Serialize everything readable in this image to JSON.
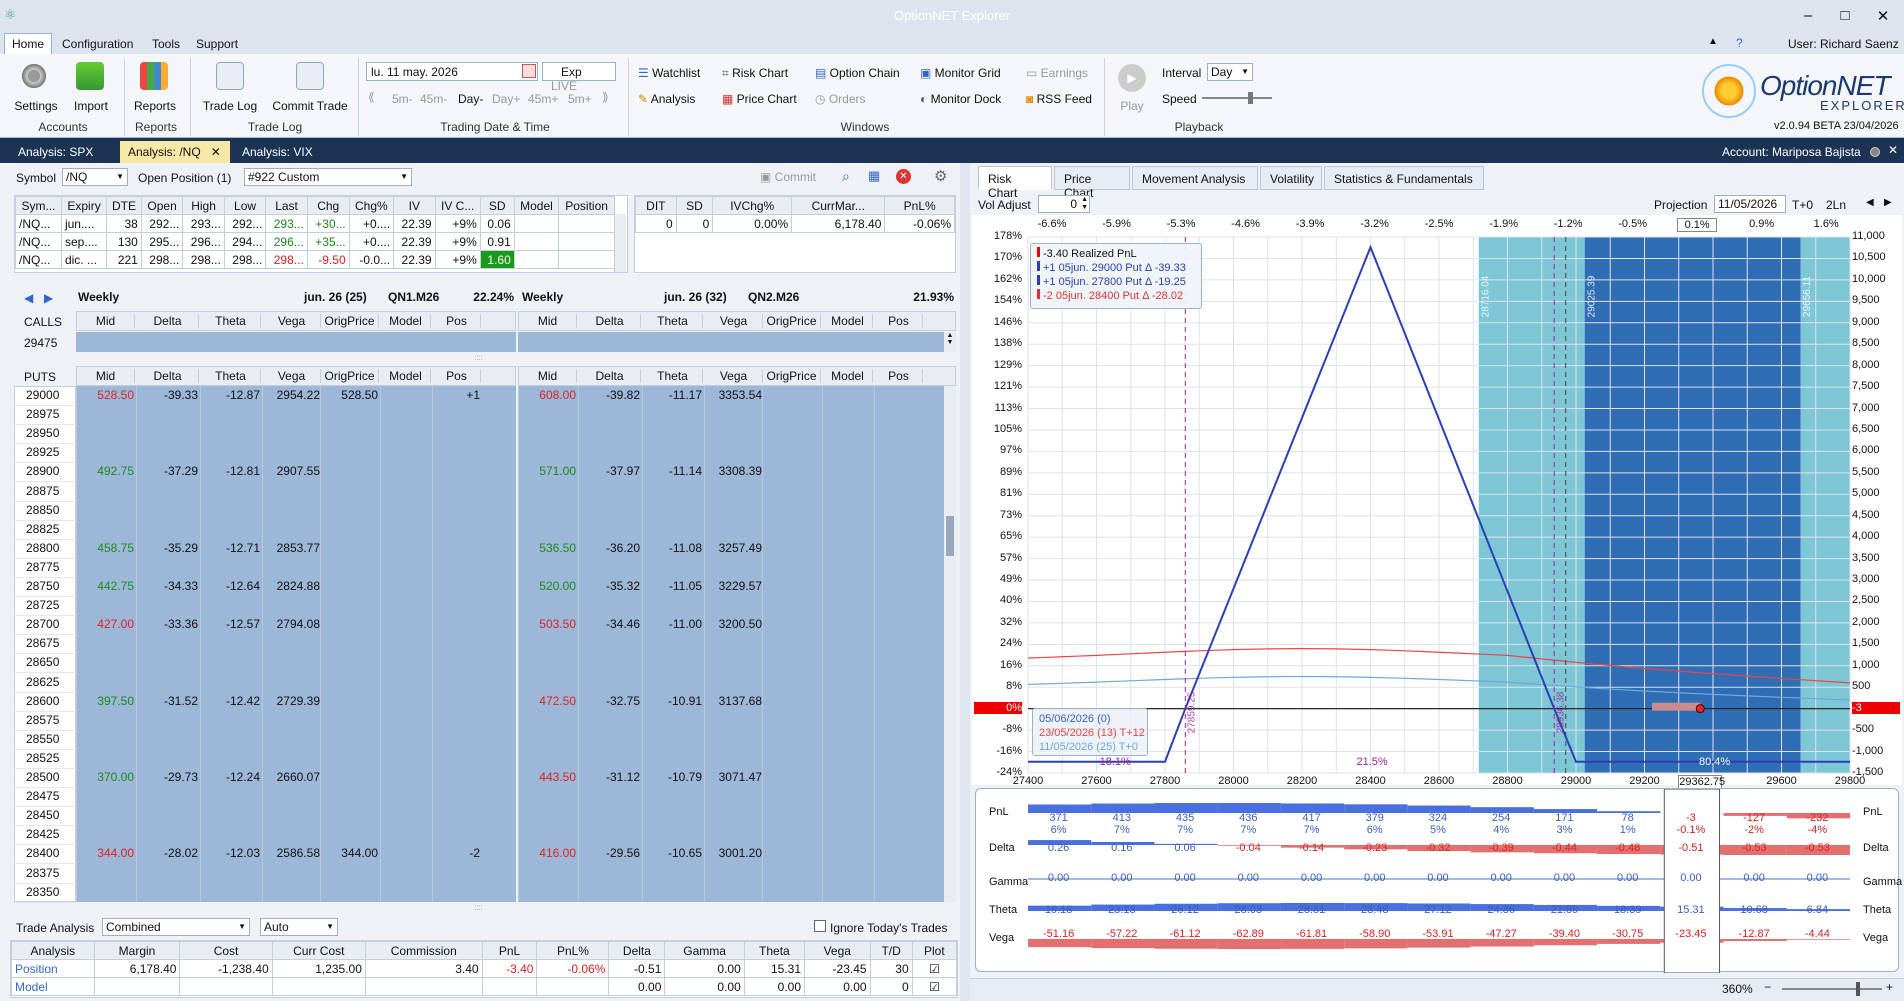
{
  "window": {
    "title": "OptionNET Explorer",
    "user": "User: Richard Saenz",
    "help": "?"
  },
  "menu": [
    "Home",
    "Configuration",
    "Tools",
    "Support"
  ],
  "ribbon": {
    "accounts": {
      "settings": "Settings",
      "import": "Import",
      "group": "Accounts"
    },
    "reports": {
      "reports": "Reports",
      "group": "Reports"
    },
    "tradelog": {
      "tradelog": "Trade Log",
      "commit": "Commit Trade",
      "group": "Trade Log"
    },
    "date": {
      "value": "lu. 11 may. 2026",
      "exp": "Exp",
      "live": "LIVE",
      "steps": [
        "5m-",
        "45m-",
        "Day-",
        "Day+",
        "45m+",
        "5m+"
      ],
      "group": "Trading Date & Time"
    },
    "windows": {
      "watchlist": "Watchlist",
      "risk_chart": "Risk Chart",
      "option_chain": "Option Chain",
      "monitor_grid": "Monitor Grid",
      "earnings": "Earnings",
      "analysis": "Analysis",
      "price_chart": "Price Chart",
      "orders": "Orders",
      "monitor_dock": "Monitor Dock",
      "rss_feed": "RSS Feed",
      "group": "Windows"
    },
    "playback": {
      "play": "Play",
      "interval_label": "Interval",
      "interval_value": "Day",
      "speed_label": "Speed",
      "group": "Playback"
    },
    "logo": {
      "line1": "OptionNET",
      "line2": "EXPLORER",
      "version": "v2.0.94 BETA 23/04/2026"
    }
  },
  "doc_tabs": [
    "Analysis: SPX",
    "Analysis: /NQ",
    "Analysis: VIX"
  ],
  "account": "Account: Mariposa Bajista",
  "symbol_bar": {
    "symbol_label": "Symbol",
    "symbol_value": "/NQ",
    "open_pos_label": "Open Position (1)",
    "position_value": "#922 Custom",
    "commit": "Commit"
  },
  "quotes": {
    "headers": [
      "Sym...",
      "Expiry",
      "DTE",
      "Open",
      "High",
      "Low",
      "Last",
      "Chg",
      "Chg%",
      "IV",
      "IV C...",
      "SD",
      "Model",
      "Position"
    ],
    "rows": [
      [
        "/NQ...",
        "jun....",
        "38",
        "292...",
        "293...",
        "292...",
        "293...",
        "+30...",
        "+0....",
        "22.39",
        "+9%",
        "0.06",
        "",
        ""
      ],
      [
        "/NQ...",
        "sep....",
        "130",
        "295...",
        "296...",
        "294...",
        "296...",
        "+35...",
        "+0....",
        "22.39",
        "+9%",
        "0.91",
        "",
        ""
      ],
      [
        "/NQ...",
        "dic. ...",
        "221",
        "298...",
        "298...",
        "298...",
        "298...",
        "-9.50",
        "-0.0...",
        "22.39",
        "+9%",
        "1.60",
        "",
        ""
      ]
    ]
  },
  "summary": {
    "headers": [
      "DIT",
      "SD",
      "IVChg%",
      "CurrMar...",
      "PnL%"
    ],
    "values": [
      "0",
      "0",
      "0.00%",
      "6,178.40",
      "-0.06%"
    ]
  },
  "chain": {
    "left_header": {
      "label": "Weekly",
      "exp": "jun. 26 (25)",
      "code": "QN1.M26",
      "iv": "22.24%"
    },
    "right_header": {
      "label": "Weekly",
      "exp": "jun. 26 (32)",
      "code": "QN2.M26",
      "iv": "21.93%"
    },
    "cols": [
      "Mid",
      "Delta",
      "Theta",
      "Vega",
      "OrigPrice",
      "Model",
      "Pos"
    ],
    "calls_label": "CALLS",
    "calls_strike": "29475",
    "puts_label": "PUTS",
    "puts": [
      {
        "strike": "29000",
        "mid": "528.50",
        "delta": "-39.33",
        "theta": "-12.87",
        "vega": "2954.22",
        "orig": "528.50",
        "pos": "+1",
        "mid2": "608.00",
        "delta2": "-39.82",
        "theta2": "-11.17",
        "vega2": "3353.54",
        "c": "red"
      },
      {
        "strike": "28975"
      },
      {
        "strike": "28950"
      },
      {
        "strike": "28925"
      },
      {
        "strike": "28900",
        "mid": "492.75",
        "delta": "-37.29",
        "theta": "-12.81",
        "vega": "2907.55",
        "mid2": "571.00",
        "delta2": "-37.97",
        "theta2": "-11.14",
        "vega2": "3308.39",
        "c": "green"
      },
      {
        "strike": "28875"
      },
      {
        "strike": "28850"
      },
      {
        "strike": "28825"
      },
      {
        "strike": "28800",
        "mid": "458.75",
        "delta": "-35.29",
        "theta": "-12.71",
        "vega": "2853.77",
        "mid2": "536.50",
        "delta2": "-36.20",
        "theta2": "-11.08",
        "vega2": "3257.49",
        "c": "green"
      },
      {
        "strike": "28775"
      },
      {
        "strike": "28750",
        "mid": "442.75",
        "delta": "-34.33",
        "theta": "-12.64",
        "vega": "2824.88",
        "mid2": "520.00",
        "delta2": "-35.32",
        "theta2": "-11.05",
        "vega2": "3229.57",
        "c": "green"
      },
      {
        "strike": "28725"
      },
      {
        "strike": "28700",
        "mid": "427.00",
        "delta": "-33.36",
        "theta": "-12.57",
        "vega": "2794.08",
        "mid2": "503.50",
        "delta2": "-34.46",
        "theta2": "-11.00",
        "vega2": "3200.50",
        "c": "red"
      },
      {
        "strike": "28675"
      },
      {
        "strike": "28650"
      },
      {
        "strike": "28625"
      },
      {
        "strike": "28600",
        "mid": "397.50",
        "delta": "-31.52",
        "theta": "-12.42",
        "vega": "2729.39",
        "mid2": "472.50",
        "delta2": "-32.75",
        "theta2": "-10.91",
        "vega2": "3137.68",
        "c": "green",
        "c2": "red"
      },
      {
        "strike": "28575"
      },
      {
        "strike": "28550"
      },
      {
        "strike": "28525"
      },
      {
        "strike": "28500",
        "mid": "370.00",
        "delta": "-29.73",
        "theta": "-12.24",
        "vega": "2660.07",
        "mid2": "443.50",
        "delta2": "-31.12",
        "theta2": "-10.79",
        "vega2": "3071.47",
        "c": "green",
        "c2": "red"
      },
      {
        "strike": "28475"
      },
      {
        "strike": "28450"
      },
      {
        "strike": "28425"
      },
      {
        "strike": "28400",
        "mid": "344.00",
        "delta": "-28.02",
        "theta": "-12.03",
        "vega": "2586.58",
        "orig": "344.00",
        "pos": "-2",
        "mid2": "416.00",
        "delta2": "-29.56",
        "theta2": "-10.65",
        "vega2": "3001.20",
        "c": "red",
        "c2": "red"
      },
      {
        "strike": "28375"
      },
      {
        "strike": "28350"
      }
    ]
  },
  "trade_analysis": {
    "label": "Trade Analysis",
    "mode": "Combined",
    "auto": "Auto",
    "ignore": "Ignore Today's Trades",
    "headers": [
      "Analysis",
      "Margin",
      "Cost",
      "Curr Cost",
      "Commission",
      "PnL",
      "PnL%",
      "Delta",
      "Gamma",
      "Theta",
      "Vega",
      "T/D",
      "Plot"
    ],
    "rows": [
      [
        "Position",
        "6,178.40",
        "-1,238.40",
        "1,235.00",
        "3.40",
        "-3.40",
        "-0.06%",
        "-0.51",
        "0.00",
        "15.31",
        "-23.45",
        "30",
        ""
      ],
      [
        "Model",
        "",
        "",
        "",
        "",
        "",
        "",
        "0.00",
        "0.00",
        "0.00",
        "0.00",
        "0",
        ""
      ]
    ]
  },
  "right_tabs": [
    "Risk Chart",
    "Price Chart",
    "Movement Analysis",
    "Volatility",
    "Statistics & Fundamentals"
  ],
  "risk": {
    "vol_adjust_label": "Vol Adjust",
    "vol_adjust_value": "0",
    "projection_label": "Projection",
    "projection_date": "11/05/2026",
    "t0": "T+0",
    "ln": "2Ln",
    "top_axis": [
      "-6.6%",
      "-5.9%",
      "-5.3%",
      "-4.6%",
      "-3.9%",
      "-3.2%",
      "-2.5%",
      "-1.9%",
      "-1.2%",
      "-0.5%",
      "0.1%",
      "0.9%",
      "1.6%"
    ],
    "left_axis": [
      "178%",
      "170%",
      "162%",
      "154%",
      "146%",
      "138%",
      "129%",
      "121%",
      "113%",
      "105%",
      "97%",
      "89%",
      "81%",
      "73%",
      "65%",
      "57%",
      "49%",
      "40%",
      "32%",
      "24%",
      "16%",
      "8%",
      "0%",
      "-8%",
      "-16%",
      "-24%"
    ],
    "right_axis": [
      "11,000",
      "10,500",
      "10,000",
      "9,500",
      "9,000",
      "8,500",
      "8,000",
      "7,500",
      "7,000",
      "6,500",
      "6,000",
      "5,500",
      "5,000",
      "4,500",
      "4,000",
      "3,500",
      "3,000",
      "2,500",
      "2,000",
      "1,500",
      "1,000",
      "500",
      "-3",
      "-500",
      "-1,000",
      "-1,500"
    ],
    "bottom_axis": [
      "27400",
      "27600",
      "27800",
      "28000",
      "28200",
      "28400",
      "28600",
      "28800",
      "29000",
      "29200",
      "29362.75",
      "29600",
      "29800"
    ],
    "legend": [
      "-3.40 Realized PnL",
      "+1 05jun. 29000 Put Δ -39.33",
      "+1 05jun. 27800 Put Δ -19.25",
      "-2 05jun. 28400 Put Δ -28.02"
    ],
    "dates_legend": [
      "05/06/2026 (0)",
      "23/05/2026 (13) T+12",
      "11/05/2026 (25) T+0"
    ],
    "vlabels": [
      "28716.04",
      "29025.39",
      "29656.11",
      "27859.25",
      "28936.38"
    ],
    "annotations": [
      "18.1%",
      "21.5%",
      "80.4%"
    ]
  },
  "chart_data": {
    "type": "line",
    "xlabel": "",
    "ylabel": "",
    "xlim": [
      27400,
      29800
    ],
    "ylim": [
      -1500,
      11000
    ],
    "series": [
      {
        "name": "05/06/2026 (0)",
        "x": [
          27400,
          27700,
          27800,
          27859.25,
          28400,
          28936.38,
          29000,
          29800
        ],
        "y": [
          -1238,
          -1238,
          -1238,
          0,
          10762,
          0,
          -1238,
          -1238
        ]
      }
    ]
  },
  "greeks_strip": {
    "labels": [
      "PnL",
      "Delta",
      "Gamma",
      "Theta",
      "Vega"
    ],
    "pnl": [
      "371",
      "413",
      "435",
      "436",
      "417",
      "379",
      "324",
      "254",
      "171",
      "78",
      "-3",
      "-127",
      "-232"
    ],
    "pnl_pct": [
      "6%",
      "7%",
      "7%",
      "7%",
      "7%",
      "6%",
      "5%",
      "4%",
      "3%",
      "1%",
      "-0.1%",
      "-2%",
      "-4%"
    ],
    "delta": [
      "0.26",
      "0.16",
      "0.06",
      "-0.04",
      "-0.14",
      "-0.23",
      "-0.32",
      "-0.39",
      "-0.44",
      "-0.48",
      "-0.51",
      "-0.53",
      "-0.53"
    ],
    "gamma": [
      "0.00",
      "0.00",
      "0.00",
      "0.00",
      "0.00",
      "0.00",
      "0.00",
      "0.00",
      "0.00",
      "0.00",
      "0.00",
      "0.00",
      "0.00"
    ],
    "theta": [
      "19.18",
      "23.13",
      "26.12",
      "28.03",
      "28.81",
      "28.48",
      "27.12",
      "24.86",
      "21.89",
      "18.39",
      "15.31",
      "10.68",
      "6.84"
    ],
    "vega": [
      "-51.16",
      "-57.22",
      "-61.12",
      "-62.89",
      "-61.81",
      "-58.90",
      "-53.91",
      "-47.27",
      "-39.40",
      "-30.75",
      "-23.45",
      "-12.87",
      "-4.44"
    ]
  },
  "zoom": "360%"
}
